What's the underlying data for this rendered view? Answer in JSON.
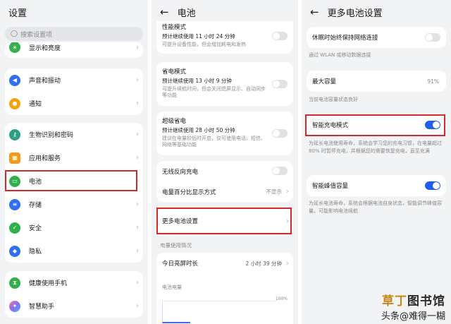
{
  "left": {
    "title": "设置",
    "search_placeholder": "搜索设置项",
    "partial_item": "显示和亮度",
    "group1": [
      "声音和振动",
      "通知"
    ],
    "group2": [
      "生物识别和密码",
      "应用和服务",
      "电池",
      "存储",
      "安全",
      "隐私"
    ],
    "group3": [
      "健康使用手机",
      "智慧助手"
    ]
  },
  "middle": {
    "title": "电池",
    "items": [
      {
        "title": "性能模式",
        "sub1": "预计继续使用 11 小时 24 分钟",
        "sub2": "可提升设备性能，但会增加耗电和发热"
      },
      {
        "title": "省电模式",
        "sub1": "预计继续使用 13 小时 9 分钟",
        "sub2": "可提升续航时间，但会关闭熄屏显示、自动同步等功能"
      },
      {
        "title": "超级省电",
        "sub1": "预计继续使用 28 小时 50 分钟",
        "sub2": "建议在电量较低时开启，仅可使用电话、短信、网络等基础功能"
      }
    ],
    "wireless_label": "无线反向充电",
    "percent_label": "电量百分比显示方式",
    "percent_value": "不显示",
    "more_label": "更多电池设置",
    "usage_section": "电量使用情况",
    "screen_label": "今日亮屏时长",
    "screen_value": "2 小时 39 分钟",
    "battery_label": "电池电量",
    "chart_max": "100%"
  },
  "right": {
    "title": "更多电池设置",
    "sleep_label": "休眠时始终保持网络连接",
    "sleep_desc": "通过 WLAN 或移动数据连接",
    "capacity_label": "最大容量",
    "capacity_value": "91%",
    "capacity_desc": "当前电池容量状态良好",
    "smart_label": "智能充电模式",
    "smart_desc": "为延长电池使用寿命，系统会学习您的充电习惯，在电量超过 80% 时暂停充电，并根据您的需要恢复充电，直至充满",
    "peak_label": "智能峰值容量",
    "peak_desc": "为延长电池寿命，系统会根据电池自身状态，智能调节峰值容量。可能影响电池续航"
  },
  "watermark": {
    "brand_a": "草丁",
    "brand_b": "图书馆",
    "sub": "头条@难得一糊"
  },
  "colors": {
    "accent": "#1f5ef0",
    "highlight": "#d42a2a"
  }
}
